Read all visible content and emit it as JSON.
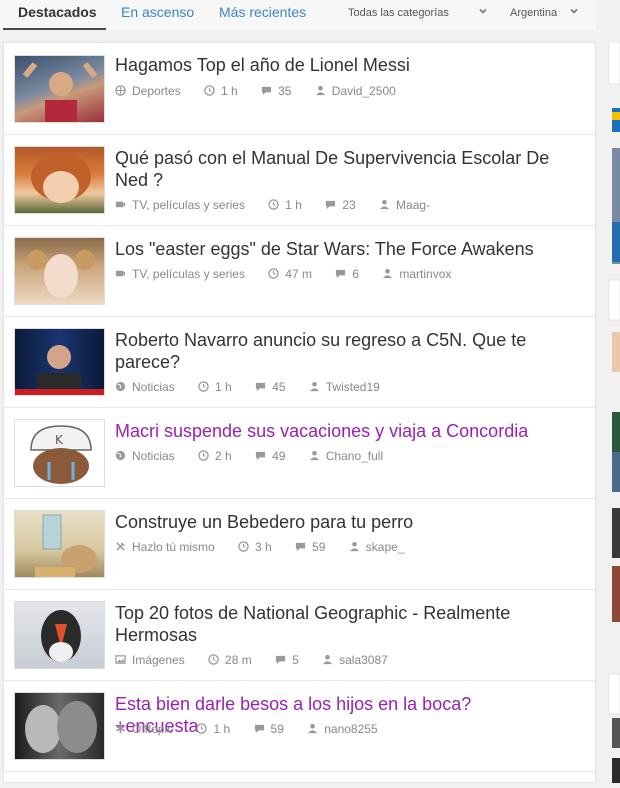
{
  "tabs": [
    {
      "label": "Destacados"
    },
    {
      "label": "En ascenso"
    },
    {
      "label": "Más recientes"
    }
  ],
  "filters": {
    "category": "Todas las categorías",
    "country": "Argentina"
  },
  "posts": [
    {
      "title": "Hagamos Top el año de Lionel Messi",
      "category": "Deportes",
      "category_icon": "ball-icon",
      "time": "1 h",
      "comments": "35",
      "author": "David_2500",
      "visited": false
    },
    {
      "title": "Qué pasó con el Manual De Supervivencia Escolar De Ned ?",
      "category": "TV, películas y series",
      "category_icon": "film-icon",
      "time": "1 h",
      "comments": "23",
      "author": "Maag-",
      "visited": false
    },
    {
      "title": "Los \"easter eggs\" de Star Wars: The Force Awakens",
      "category": "TV, películas y series",
      "category_icon": "film-icon",
      "time": "47 m",
      "comments": "6",
      "author": "martinvox",
      "visited": false
    },
    {
      "title": "Roberto Navarro anuncio su regreso a C5N. Que te parece?",
      "category": "Noticias",
      "category_icon": "globe-icon",
      "time": "1 h",
      "comments": "45",
      "author": "Twisted19",
      "visited": false
    },
    {
      "title": "Macri suspende sus vacaciones y viaja a Concordia",
      "category": "Noticias",
      "category_icon": "globe-icon",
      "time": "2 h",
      "comments": "49",
      "author": "Chano_full",
      "visited": true
    },
    {
      "title": "Construye un Bebedero para tu perro",
      "category": "Hazlo tú mismo",
      "category_icon": "tools-icon",
      "time": "3 h",
      "comments": "59",
      "author": "skape_",
      "visited": false
    },
    {
      "title": "Top 20 fotos de National Geographic - Realmente Hermosas",
      "category": "Imágenes",
      "category_icon": "image-icon",
      "time": "28 m",
      "comments": "5",
      "author": "sala3087",
      "visited": false
    },
    {
      "title": "Esta bien darle besos a los hijos en la boca? +encuesta",
      "category": "Offtopic",
      "category_icon": "asterisk-icon",
      "time": "1 h",
      "comments": "59",
      "author": "nano8255",
      "visited": true
    }
  ],
  "colors": {
    "link": "#3b86c8",
    "visited_title": "#9b1fb5",
    "meta": "#888888"
  }
}
